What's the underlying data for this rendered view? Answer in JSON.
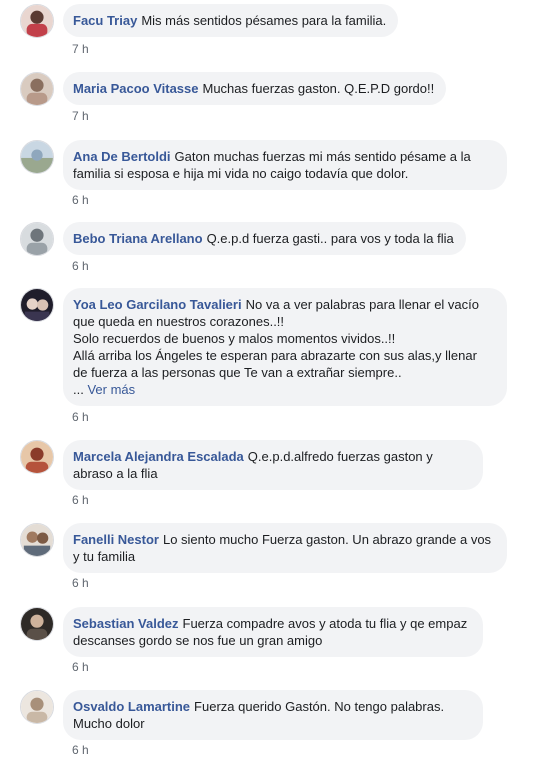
{
  "comments": [
    {
      "author": "Facu Triay",
      "text": "Mis más sentidos pésames para la familia.",
      "time": "7 h",
      "avatar_color": "#c2404a"
    },
    {
      "author": "Maria Pacoo Vitasse",
      "text": "Muchas fuerzas gaston. Q.E.P.D gordo!!",
      "time": "7 h",
      "avatar_color": "#b89a8a"
    },
    {
      "author": "Ana De Bertoldi",
      "text": "Gaton muchas fuerzas mi más sentido pésame a la familia si esposa e hija mi vida no caigo todavía que dolor.",
      "time": "6 h",
      "avatar_color": "#8fa7bd"
    },
    {
      "author": "Bebo Triana Arellano",
      "text": "Q.e.p.d fuerza gasti.. para vos y toda la flia",
      "time": "6 h",
      "avatar_color": "#9aa2a8"
    },
    {
      "author": "Yoa Leo Garcilano Tavalieri",
      "text": "No va a ver palabras para llenar el vacío que queda en nuestros corazones..!!\nSolo recuerdos de buenos y malos momentos vividos..!!\nAllá arriba los Ángeles te esperan para abrazarte con sus alas,y llenar de fuerza a las personas que Te van a extrañar siempre..",
      "more_prefix": "... ",
      "more": "Ver más",
      "time": "6 h",
      "avatar_color": "#3a3550"
    },
    {
      "author": "Marcela Alejandra Escalada",
      "text": "Q.e.p.d.alfredo fuerzas gaston y abraso a la flia",
      "time": "6 h",
      "avatar_color": "#b5533c"
    },
    {
      "author": "Fanelli Nestor",
      "text": "Lo siento mucho Fuerza gaston. Un abrazo grande a vos y tu familia",
      "time": "6 h",
      "avatar_color": "#a07a60"
    },
    {
      "author": "Sebastian Valdez",
      "text": "Fuerza compadre avos y atoda tu flia y qe empaz descanses gordo se nos fue un gran amigo",
      "time": "6 h",
      "avatar_color": "#5a5048"
    },
    {
      "author": "Osvaldo Lamartine",
      "text": "Fuerza querido Gastón. No tengo palabras. Mucho dolor",
      "time": "6 h",
      "avatar_color": "#c9b8a6"
    }
  ]
}
